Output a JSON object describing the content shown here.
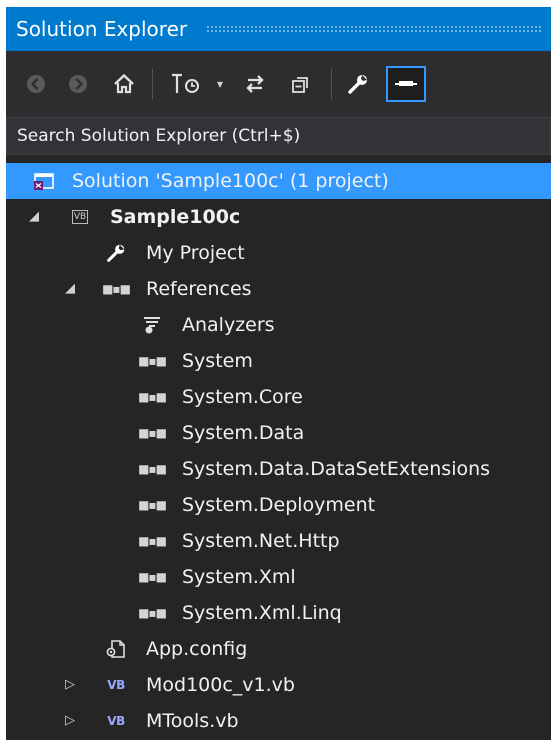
{
  "window": {
    "title": "Solution Explorer"
  },
  "toolbar": {
    "buttons": [
      {
        "name": "back-button",
        "icon": "back-arrow-icon",
        "glyph": "←",
        "enabled": false
      },
      {
        "name": "forward-button",
        "icon": "forward-arrow-icon",
        "glyph": "→",
        "enabled": false
      },
      {
        "name": "home-button",
        "icon": "home-icon",
        "glyph": "⌂",
        "enabled": true
      },
      {
        "name": "pending-changes-filter-button",
        "icon": "clock-filter-icon",
        "glyph": "◷",
        "enabled": true
      },
      {
        "name": "pending-changes-dropdown",
        "icon": "chevron-down-icon",
        "glyph": "▾",
        "enabled": true
      },
      {
        "name": "sync-active-document-button",
        "icon": "sync-arrows-icon",
        "glyph": "⇆",
        "enabled": true
      },
      {
        "name": "collapse-all-button",
        "icon": "collapse-all-icon",
        "glyph": "❐",
        "enabled": true
      },
      {
        "name": "properties-button",
        "icon": "wrench-icon",
        "glyph": "⚒",
        "enabled": true
      },
      {
        "name": "preview-selected-items-button",
        "icon": "preview-icon",
        "glyph": "—",
        "enabled": true,
        "active": true
      }
    ]
  },
  "search": {
    "placeholder": "Search Solution Explorer (Ctrl+$)",
    "value": ""
  },
  "tree": {
    "solution": {
      "label": "Solution 'Sample100c' (1 project)",
      "icon": "solution-icon"
    },
    "project": {
      "label": "Sample100c",
      "icon": "vb-project-icon",
      "icon_text": "VB"
    },
    "my_project": {
      "label": "My Project",
      "icon": "wrench-icon"
    },
    "references": {
      "label": "References",
      "icon": "references-icon",
      "items": [
        {
          "label": "Analyzers",
          "icon": "analyzers-icon"
        },
        {
          "label": "System",
          "icon": "reference-icon"
        },
        {
          "label": "System.Core",
          "icon": "reference-icon"
        },
        {
          "label": "System.Data",
          "icon": "reference-icon"
        },
        {
          "label": "System.Data.DataSetExtensions",
          "icon": "reference-icon"
        },
        {
          "label": "System.Deployment",
          "icon": "reference-icon"
        },
        {
          "label": "System.Net.Http",
          "icon": "reference-icon"
        },
        {
          "label": "System.Xml",
          "icon": "reference-icon"
        },
        {
          "label": "System.Xml.Linq",
          "icon": "reference-icon"
        }
      ]
    },
    "app_config": {
      "label": "App.config",
      "icon": "config-file-icon"
    },
    "files": [
      {
        "label": "Mod100c_v1.vb",
        "icon": "vb-file-icon",
        "icon_text": "VB"
      },
      {
        "label": "MTools.vb",
        "icon": "vb-file-icon",
        "icon_text": "VB"
      }
    ]
  },
  "colors": {
    "accent": "#007acc",
    "selection": "#3399ff",
    "background": "#252526",
    "toolbar": "#2d2d30",
    "text": "#f1f1f1"
  }
}
